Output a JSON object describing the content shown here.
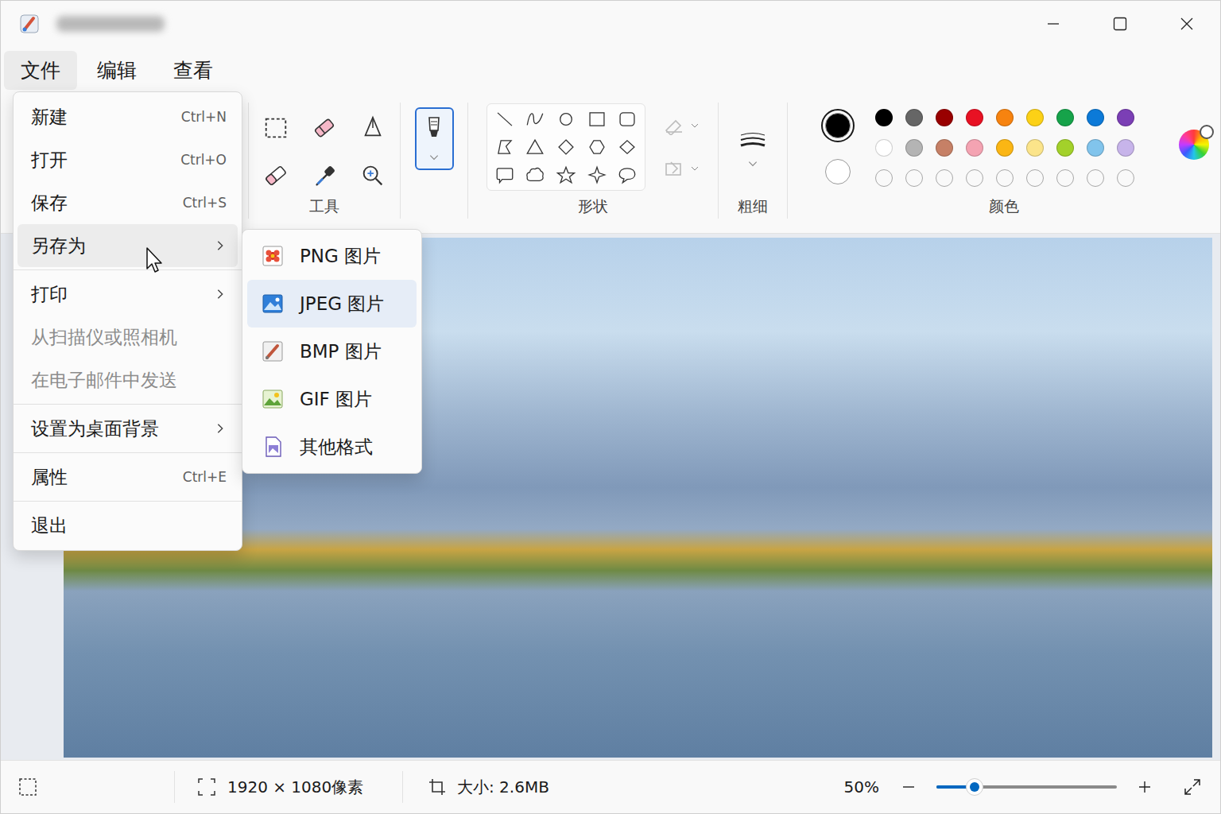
{
  "menubar": [
    {
      "label": "文件",
      "selected": true
    },
    {
      "label": "编辑",
      "selected": false
    },
    {
      "label": "查看",
      "selected": false
    }
  ],
  "toolbar": {
    "tools_label": "工具",
    "brush": {
      "selected": true
    },
    "shapes_label": "形状",
    "size_label": "粗细",
    "colors_label": "颜色",
    "current_colors": [
      {
        "color": "#000000",
        "selected": true
      },
      {
        "color": "#ffffff",
        "selected": false
      }
    ],
    "palette": [
      {
        "color": "#000000",
        "empty": false
      },
      {
        "color": "#666666",
        "empty": false
      },
      {
        "color": "#990000",
        "empty": false
      },
      {
        "color": "#e81123",
        "empty": false
      },
      {
        "color": "#f7830f",
        "empty": false
      },
      {
        "color": "#fcd116",
        "empty": false
      },
      {
        "color": "#16a34a",
        "empty": false
      },
      {
        "color": "#0c7ad8",
        "empty": false
      },
      {
        "color": "#7b3fb5",
        "empty": false
      },
      {
        "color": "#ffffff",
        "empty": false
      },
      {
        "color": "#b4b4b4",
        "empty": false
      },
      {
        "color": "#c68066",
        "empty": false
      },
      {
        "color": "#f4a3b2",
        "empty": false
      },
      {
        "color": "#fbb614",
        "empty": false
      },
      {
        "color": "#fbe48a",
        "empty": false
      },
      {
        "color": "#a3d12a",
        "empty": false
      },
      {
        "color": "#81c4ec",
        "empty": false
      },
      {
        "color": "#c7b4ea",
        "empty": false
      },
      {
        "empty": true
      },
      {
        "empty": true
      },
      {
        "empty": true
      },
      {
        "empty": true
      },
      {
        "empty": true
      },
      {
        "empty": true
      },
      {
        "empty": true
      },
      {
        "empty": true
      },
      {
        "empty": true
      }
    ]
  },
  "file_menu": {
    "items": [
      {
        "kind": "item",
        "label": "新建",
        "shortcut": "Ctrl+N",
        "submenu": false,
        "disabled": false,
        "selected": false
      },
      {
        "kind": "item",
        "label": "打开",
        "shortcut": "Ctrl+O",
        "submenu": false,
        "disabled": false,
        "selected": false
      },
      {
        "kind": "item",
        "label": "保存",
        "shortcut": "Ctrl+S",
        "submenu": false,
        "disabled": false,
        "selected": false
      },
      {
        "kind": "item",
        "label": "另存为",
        "submenu": true,
        "disabled": false,
        "selected": true
      },
      {
        "kind": "separator"
      },
      {
        "kind": "item",
        "label": "打印",
        "submenu": true,
        "disabled": false,
        "selected": false
      },
      {
        "kind": "item",
        "label": "从扫描仪或照相机",
        "submenu": false,
        "disabled": true,
        "selected": false
      },
      {
        "kind": "item",
        "label": "在电子邮件中发送",
        "submenu": false,
        "disabled": true,
        "selected": false
      },
      {
        "kind": "separator"
      },
      {
        "kind": "item",
        "label": "设置为桌面背景",
        "submenu": true,
        "disabled": false,
        "selected": false
      },
      {
        "kind": "separator"
      },
      {
        "kind": "item",
        "label": "属性",
        "shortcut": "Ctrl+E",
        "submenu": false,
        "disabled": false,
        "selected": false
      },
      {
        "kind": "separator"
      },
      {
        "kind": "item",
        "label": "退出",
        "submenu": false,
        "disabled": false,
        "selected": false
      }
    ]
  },
  "save_as_menu": {
    "items": [
      {
        "label": "PNG 图片",
        "selected": false
      },
      {
        "label": "JPEG 图片",
        "selected": true
      },
      {
        "label": "BMP 图片",
        "selected": false
      },
      {
        "label": "GIF 图片",
        "selected": false
      },
      {
        "label": "其他格式",
        "selected": false
      }
    ]
  },
  "status_bar": {
    "dimensions": "1920 × 1080像素",
    "size": "大小: 2.6MB",
    "zoom": "50%",
    "zoom_level": 0.21
  }
}
